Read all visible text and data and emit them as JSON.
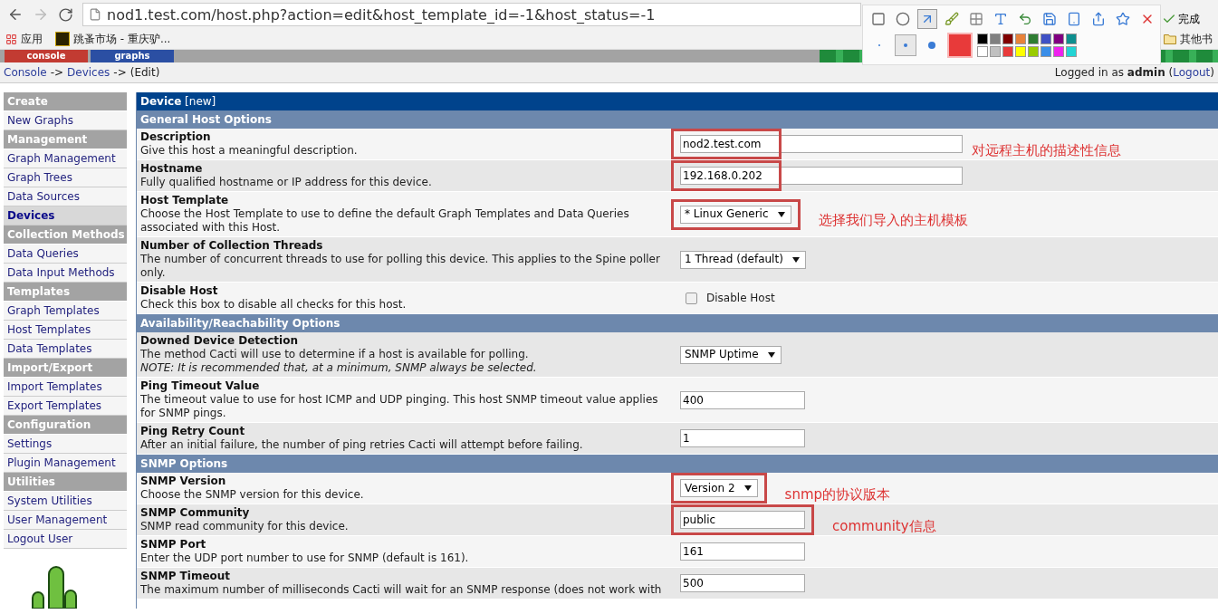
{
  "browser": {
    "url": "nod1.test.com/host.php?action=edit&host_template_id=-1&host_status=-1",
    "bookmarks": [
      {
        "label": "应用"
      },
      {
        "label": "跳蚤市场 - 重庆驴..."
      }
    ],
    "other_bookmarks": "其他书"
  },
  "capture_toolbar": {
    "tools": [
      {
        "selected": false
      },
      {
        "selected": false
      },
      {
        "selected": true
      },
      {
        "selected": false
      },
      {
        "selected": false
      },
      {
        "selected": false
      },
      {
        "selected": false
      },
      {
        "selected": false
      },
      {
        "selected": false
      },
      {
        "selected": false
      },
      {
        "selected": false
      },
      {
        "selected": false
      }
    ],
    "done_button": "完成",
    "pen_sizes": [
      {
        "selected": false
      },
      {
        "selected": true
      },
      {
        "selected": false
      }
    ],
    "current_color": {
      "color": "#e83a3a"
    },
    "palette": [
      {
        "color": "#000000"
      },
      {
        "color": "#808080"
      },
      {
        "color": "#800000"
      },
      {
        "color": "#e8823a"
      },
      {
        "color": "#2e7d32"
      },
      {
        "color": "#3f51c5"
      },
      {
        "color": "#800080"
      },
      {
        "color": "#0e8f8f"
      },
      {
        "color": "#ffffff"
      },
      {
        "color": "#c0c0c0"
      },
      {
        "color": "#e83a3a"
      },
      {
        "color": "#ffff00"
      },
      {
        "color": "#99cc00"
      },
      {
        "color": "#3a8ee8"
      },
      {
        "color": "#ee22ee"
      },
      {
        "color": "#22d4d4"
      }
    ]
  },
  "top_tabs": [
    {
      "label": "console",
      "selected": true
    },
    {
      "label": "graphs",
      "selected": false
    }
  ],
  "breadcrumb": [
    {
      "text": "Console",
      "kind": "link"
    },
    {
      "text": "->",
      "kind": "separator"
    },
    {
      "text": "Devices",
      "kind": "link"
    },
    {
      "text": "->",
      "kind": "separator"
    },
    {
      "text": "(Edit)",
      "kind": "current"
    }
  ],
  "login": {
    "text": "Logged in as **admin** (",
    "link": "Logout",
    "suffix": ")"
  },
  "sidebar": {
    "items": [
      {
        "label": "Create",
        "kind": "header"
      },
      {
        "label": "New Graphs",
        "kind": "link",
        "selected": false
      },
      {
        "label": "Management",
        "kind": "header"
      },
      {
        "label": "Graph Management",
        "kind": "link",
        "selected": false
      },
      {
        "label": "Graph Trees",
        "kind": "link",
        "selected": false
      },
      {
        "label": "Data Sources",
        "kind": "link",
        "selected": false
      },
      {
        "label": "Devices",
        "kind": "link",
        "selected": true
      },
      {
        "label": "Collection Methods",
        "kind": "header"
      },
      {
        "label": "Data Queries",
        "kind": "link",
        "selected": false
      },
      {
        "label": "Data Input Methods",
        "kind": "link",
        "selected": false
      },
      {
        "label": "Templates",
        "kind": "header"
      },
      {
        "label": "Graph Templates",
        "kind": "link",
        "selected": false
      },
      {
        "label": "Host Templates",
        "kind": "link",
        "selected": false
      },
      {
        "label": "Data Templates",
        "kind": "link",
        "selected": false
      },
      {
        "label": "Import/Export",
        "kind": "header"
      },
      {
        "label": "Import Templates",
        "kind": "link",
        "selected": false
      },
      {
        "label": "Export Templates",
        "kind": "link",
        "selected": false
      },
      {
        "label": "Configuration",
        "kind": "header"
      },
      {
        "label": "Settings",
        "kind": "link",
        "selected": false
      },
      {
        "label": "Plugin Management",
        "kind": "link",
        "selected": false
      },
      {
        "label": "Utilities",
        "kind": "header"
      },
      {
        "label": "System Utilities",
        "kind": "link",
        "selected": false
      },
      {
        "label": "User Management",
        "kind": "link",
        "selected": false
      },
      {
        "label": "Logout User",
        "kind": "link",
        "selected": false
      }
    ]
  },
  "form": {
    "title": "**Device** [new]",
    "sections": [
      {
        "title": "General Host Options",
        "rows": [
          {
            "label": "Description",
            "description": "Give this host a meaningful description.",
            "field": {
              "kind": "long-text",
              "value": "nod2.test.com"
            },
            "highlighted": true,
            "annotation": "对远程主机的描述性信息"
          },
          {
            "label": "Hostname",
            "description": "Fully qualified hostname or IP address for this device.",
            "field": {
              "kind": "long-text",
              "value": "192.168.0.202"
            },
            "highlighted": true
          },
          {
            "label": "Host Template",
            "description": "Choose the Host Template to use to define the default Graph Templates and Data Queries associated with this Host.",
            "field": {
              "kind": "select",
              "value": "* Linux Generic"
            },
            "highlighted": true,
            "annotation": "选择我们导入的主机模板"
          },
          {
            "label": "Number of Collection Threads",
            "description": "The number of concurrent threads to use for polling this device. This applies to the Spine poller only.",
            "field": {
              "kind": "select",
              "value": "1 Thread (default)"
            }
          },
          {
            "label": "Disable Host",
            "description": "Check this box to disable all checks for this host.",
            "field": {
              "kind": "checkbox",
              "label": "Disable Host",
              "checked": false
            }
          }
        ]
      },
      {
        "title": "Availability/Reachability Options",
        "rows": [
          {
            "label": "Downed Device Detection",
            "description": "The method Cacti will use to determine if a host is available for polling.",
            "note": "NOTE: It is recommended that, at a minimum, SNMP always be selected.",
            "field": {
              "kind": "select",
              "value": "SNMP Uptime"
            }
          },
          {
            "label": "Ping Timeout Value",
            "description": "The timeout value to use for host ICMP and UDP pinging. This host SNMP timeout value applies for SNMP pings.",
            "field": {
              "kind": "text",
              "value": "400"
            }
          },
          {
            "label": "Ping Retry Count",
            "description": "After an initial failure, the number of ping retries Cacti will attempt before failing.",
            "field": {
              "kind": "text",
              "value": "1"
            }
          }
        ]
      },
      {
        "title": "SNMP Options",
        "rows": [
          {
            "label": "SNMP Version",
            "description": "Choose the SNMP version for this device.",
            "field": {
              "kind": "select",
              "value": "Version 2"
            },
            "highlighted": true,
            "annotation": "snmp的协议版本"
          },
          {
            "label": "SNMP Community",
            "description": "SNMP read community for this device.",
            "field": {
              "kind": "text",
              "value": "public"
            },
            "highlighted": true,
            "annotation": "community信息"
          },
          {
            "label": "SNMP Port",
            "description": "Enter the UDP port number to use for SNMP (default is 161).",
            "field": {
              "kind": "text",
              "value": "161"
            }
          },
          {
            "label": "SNMP Timeout",
            "description": "The maximum number of milliseconds Cacti will wait for an SNMP response (does not work with",
            "field": {
              "kind": "text",
              "value": "500"
            }
          }
        ]
      }
    ]
  }
}
